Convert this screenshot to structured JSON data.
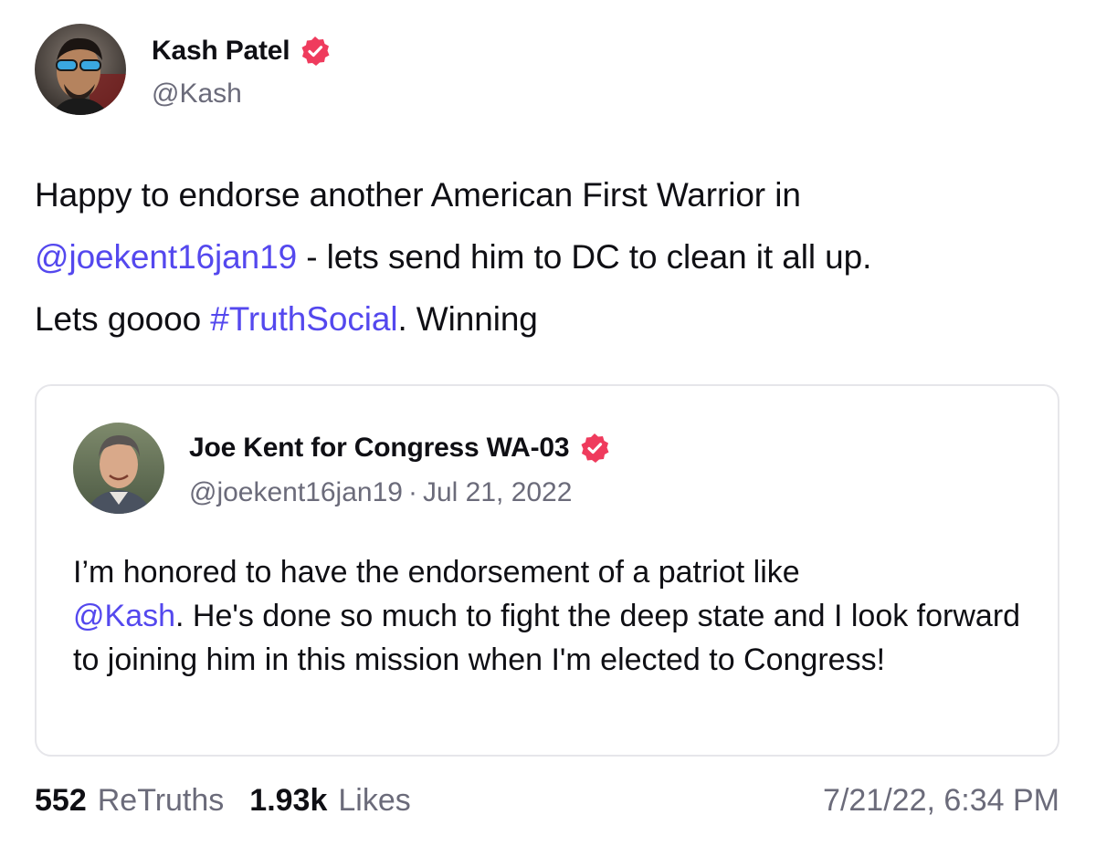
{
  "post": {
    "author": {
      "display_name": "Kash Patel",
      "handle": "@Kash",
      "verified_icon": "verified-badge-icon",
      "avatar_icon": "avatar-photo"
    },
    "text": {
      "line1": "Happy to endorse another American First Warrior in",
      "mention": "@joekent16jan19",
      "line2_rest": " - lets send him to DC to clean it all up.",
      "line3_start": "Lets goooo ",
      "hashtag": "#TruthSocial",
      "line3_end": ". Winning"
    },
    "quote": {
      "author": {
        "display_name": "Joe Kent for Congress WA-03",
        "handle": "@joekent16jan19",
        "separator": "·",
        "date": "Jul 21, 2022",
        "verified_icon": "verified-badge-icon"
      },
      "text": {
        "part1": "I’m honored to have the endorsement of a patriot like",
        "mention": "@Kash",
        "part2": ". He's done so much to fight the deep state and I look forward to joining him in this mission when I'm elected to Congress!"
      }
    },
    "stats": {
      "retruths_count": "552",
      "retruths_label": "ReTruths",
      "likes_count": "1.93k",
      "likes_label": "Likes"
    },
    "timestamp": "7/21/22, 6:34 PM"
  },
  "colors": {
    "accent_link": "#5448ee",
    "verified_badge": "#ef3b5d",
    "text_primary": "#0f0f14",
    "text_secondary": "#6b6b7a",
    "card_border": "#e6e6ea"
  }
}
